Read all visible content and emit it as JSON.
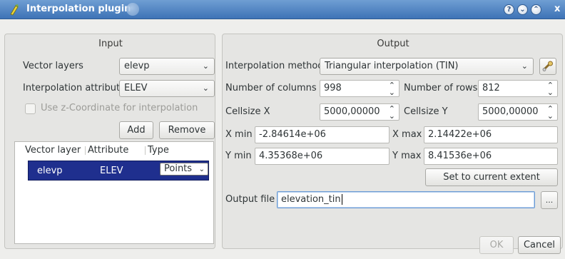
{
  "window": {
    "title": "Interpolation plugin",
    "titlebar_buttons": [
      "?",
      "⌄",
      "⌃"
    ],
    "close_glyph": "x"
  },
  "input": {
    "title": "Input",
    "vector_layers_label": "Vector layers",
    "vector_layers_value": "elevp",
    "interp_attr_label": "Interpolation attribute",
    "interp_attr_value": "ELEV",
    "use_z_label": "Use z-Coordinate for interpolation",
    "add_label": "Add",
    "remove_label": "Remove",
    "table": {
      "headers": [
        "Vector layer",
        "Attribute",
        "Type"
      ],
      "rows": [
        {
          "layer": "elevp",
          "attribute": "ELEV",
          "type": "Points"
        }
      ]
    }
  },
  "output": {
    "title": "Output",
    "method_label": "Interpolation method",
    "method_value": "Triangular interpolation (TIN)",
    "num_cols_label": "Number of columns",
    "num_cols_value": "998",
    "num_rows_label": "Number of rows",
    "num_rows_value": "812",
    "cellsize_x_label": "Cellsize X",
    "cellsize_x_value": "5000,00000",
    "cellsize_y_label": "Cellsize Y",
    "cellsize_y_value": "5000,00000",
    "xmin_label": "X min",
    "xmin_value": "-2.84614e+06",
    "xmax_label": "X max",
    "xmax_value": "2.14422e+06",
    "ymin_label": "Y min",
    "ymin_value": "4.35368e+06",
    "ymax_label": "Y max",
    "ymax_value": "8.41536e+06",
    "set_extent_label": "Set to current extent",
    "output_file_label": "Output file",
    "output_file_value": "elevation_tin",
    "browse_label": "..."
  },
  "footer": {
    "ok_label": "OK",
    "cancel_label": "Cancel"
  },
  "icons": {
    "logo": "qgis-logo-icon",
    "settings": "settings-wrench-icon"
  },
  "colors": {
    "titlebar": "#3e73b6",
    "selection": "#1f2f8e",
    "window_bg": "#eeeeec"
  }
}
